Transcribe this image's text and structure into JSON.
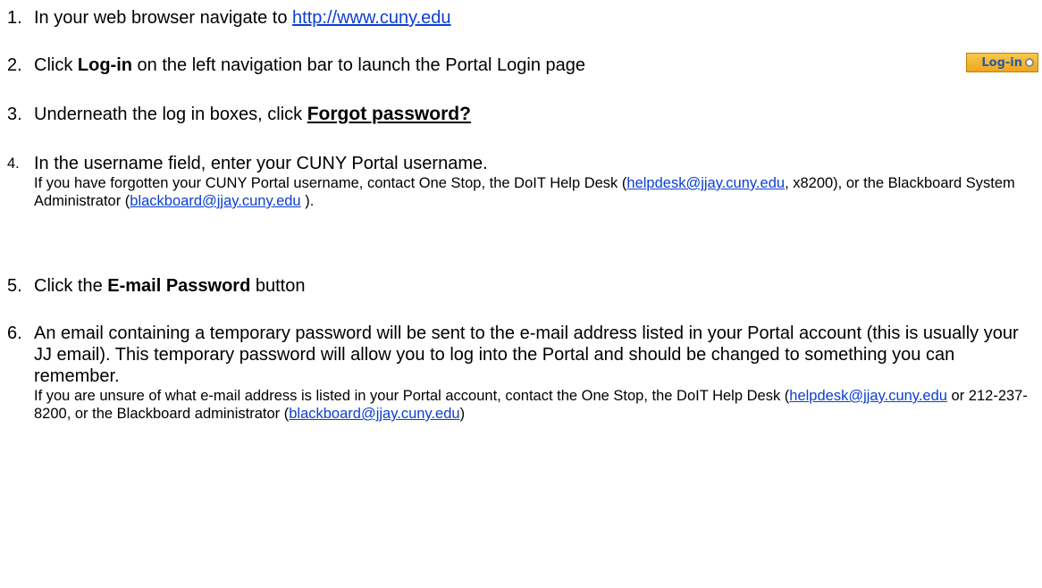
{
  "steps": [
    {
      "number": "1.",
      "text": "In your web browser navigate to ",
      "link": "http://www.cuny.edu"
    },
    {
      "number": "2.",
      "pre": "Click ",
      "bold": "Log-in",
      "post": " on the left navigation bar to launch the Portal Login page"
    },
    {
      "number": "3.",
      "pre": "Underneath the log in boxes, click ",
      "bold": "Forgot password?"
    },
    {
      "number": "4.",
      "main": "In the username field, enter your CUNY Portal username.",
      "sub_pre": "If you have forgotten your CUNY Portal username, contact One Stop, the DoIT Help Desk (",
      "sub_link1": "helpdesk@jjay.cuny.edu",
      "sub_mid": ", x8200), or the Blackboard System Administrator (",
      "sub_link2": "blackboard@jjay.cuny.edu",
      "sub_post": " )."
    },
    {
      "number": "5.",
      "pre": "Click the ",
      "bold": "E-mail Password",
      "post": " button"
    },
    {
      "number": "6.",
      "main": "An email containing a temporary password will be sent to the e-mail address listed in your Portal account (this is usually your JJ email).  This temporary password will allow you to log into the Portal and should be changed to something you can remember.",
      "sub_pre": "If you are unsure of what e-mail address is listed in your Portal account, contact the One Stop, the DoIT Help Desk (",
      "sub_link1": "helpdesk@jjay.cuny.edu",
      "sub_mid": " or 212-237-8200, or the Blackboard administrator (",
      "sub_link2": "blackboard@jjay.cuny.edu",
      "sub_post": ")"
    }
  ],
  "login_button": {
    "label": "Log-in"
  },
  "colors": {
    "link": "#0b3fd1",
    "button_bg": "#f1a51e",
    "button_text": "#2a5d9c"
  }
}
